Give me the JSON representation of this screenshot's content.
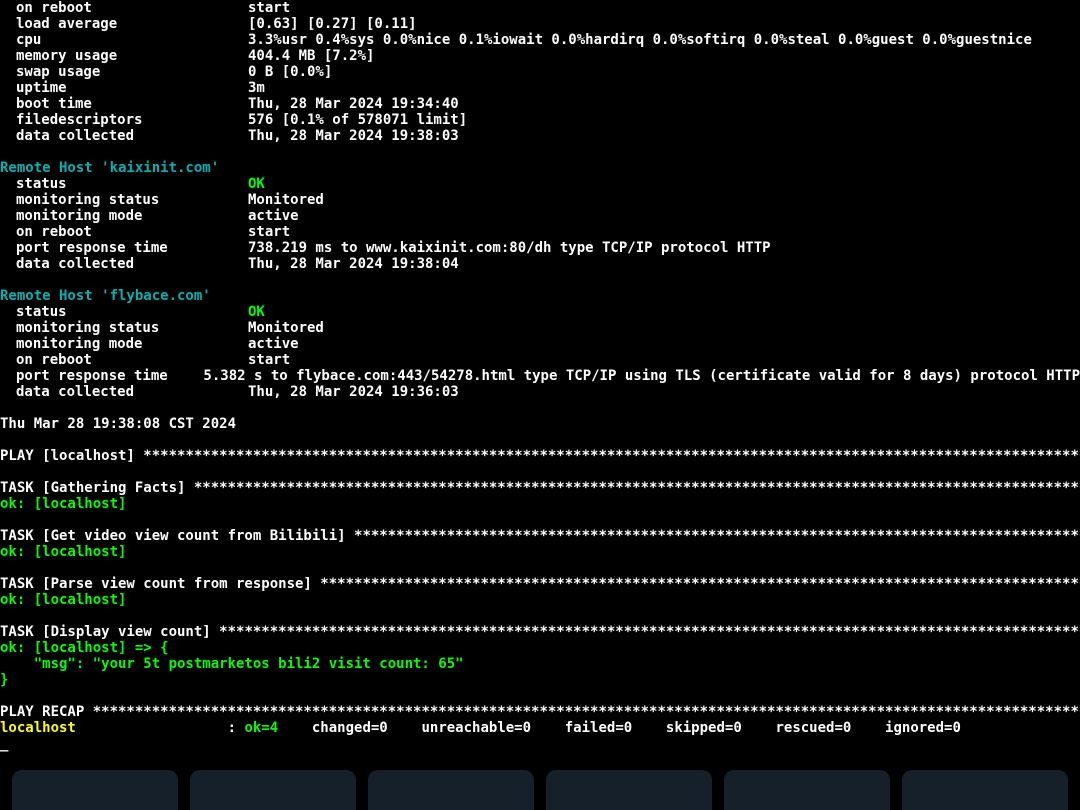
{
  "sys": [
    {
      "k": "on reboot",
      "v": "start"
    },
    {
      "k": "load average",
      "v": "[0.63] [0.27] [0.11]"
    },
    {
      "k": "cpu",
      "v": "3.3%usr 0.4%sys 0.0%nice 0.1%iowait 0.0%hardirq 0.0%softirq 0.0%steal 0.0%guest 0.0%guestnice"
    },
    {
      "k": "memory usage",
      "v": "404.4 MB [7.2%]"
    },
    {
      "k": "swap usage",
      "v": "0 B [0.0%]"
    },
    {
      "k": "uptime",
      "v": "3m"
    },
    {
      "k": "boot time",
      "v": "Thu, 28 Mar 2024 19:34:40"
    },
    {
      "k": "filedescriptors",
      "v": "576 [0.1% of 578071 limit]"
    },
    {
      "k": "data collected",
      "v": "Thu, 28 Mar 2024 19:38:03"
    }
  ],
  "rh1": {
    "header": "Remote Host 'kaixinit.com'",
    "rows": [
      {
        "k": "status",
        "v": "OK",
        "ok": true
      },
      {
        "k": "monitoring status",
        "v": "Monitored"
      },
      {
        "k": "monitoring mode",
        "v": "active"
      },
      {
        "k": "on reboot",
        "v": "start"
      },
      {
        "k": "port response time",
        "v": "738.219 ms to www.kaixinit.com:80/dh type TCP/IP protocol HTTP"
      },
      {
        "k": "data collected",
        "v": "Thu, 28 Mar 2024 19:38:04"
      }
    ]
  },
  "rh2": {
    "header": "Remote Host 'flybace.com'",
    "rows": [
      {
        "k": "status",
        "v": "OK",
        "ok": true
      },
      {
        "k": "monitoring status",
        "v": "Monitored"
      },
      {
        "k": "monitoring mode",
        "v": "active"
      },
      {
        "k": "on reboot",
        "v": "start"
      },
      {
        "k": "port response time",
        "v": "5.382 s to flybace.com:443/54278.html type TCP/IP using TLS (certificate valid for 8 days) protocol HTTP"
      },
      {
        "k": "data collected",
        "v": "Thu, 28 Mar 2024 19:36:03"
      }
    ]
  },
  "timestamp": "Thu Mar 28 19:38:08 CST 2024",
  "ansible": {
    "play_line": "PLAY [localhost] ",
    "task1": "TASK [Gathering Facts] ",
    "ok1": "ok: [localhost]",
    "task2": "TASK [Get video view count from Bilibili] ",
    "ok2": "ok: [localhost]",
    "task3": "TASK [Parse view count from response] ",
    "ok3": "ok: [localhost]",
    "task4": "TASK [Display view count] ",
    "ok4a": "ok: [localhost] => {",
    "ok4b": "    \"msg\": \"your 5t postmarketos bili2 visit count: 65\"",
    "ok4c": "}",
    "recap_line": "PLAY RECAP ",
    "recap_host": "localhost",
    "recap_colon": "                  : ",
    "recap_ok": "ok=4   ",
    "recap_rest": " changed=0    unreachable=0    failed=0    skipped=0    rescued=0    ignored=0   "
  }
}
